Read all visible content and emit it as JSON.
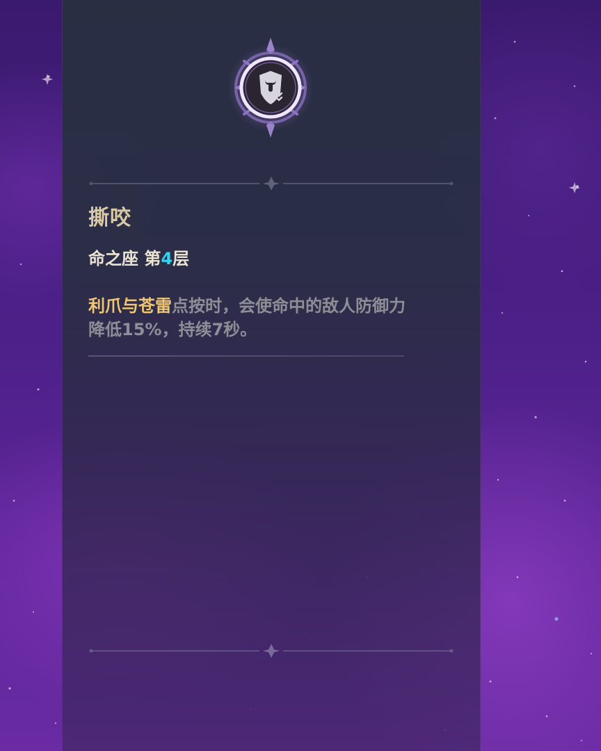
{
  "constellation": {
    "icon": "shield-claw-debuff-icon",
    "title": "撕咬",
    "level_prefix": "命之座 第",
    "level_number": "4",
    "level_suffix": "层",
    "description_highlight": "利爪与苍雷",
    "description_text": "点按时，会使命中的敌人防御力降低15%，持续7秒。"
  },
  "colors": {
    "title": "#d9c9a4",
    "level_number": "#33d2ee",
    "highlight": "#f1c673",
    "description": "#8e8e96",
    "emblem_glow": "#c9a6ff"
  }
}
